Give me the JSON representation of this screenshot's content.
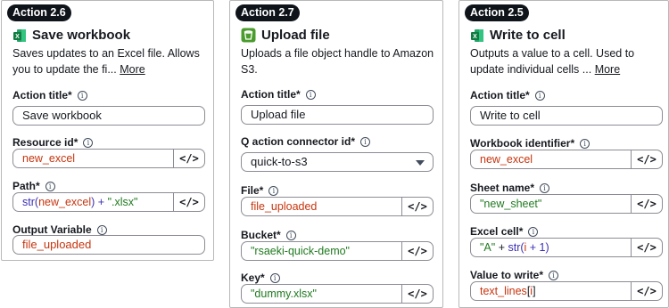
{
  "cards": [
    {
      "badge": "Action 2.6",
      "title": "Save workbook",
      "desc": "Saves updates to an Excel file. Allows you to update the fi...",
      "more": "More",
      "fields": {
        "action_title_label": "Action title*",
        "action_title_value": "Save workbook",
        "resource_id_label": "Resource id*",
        "resource_id_value": "new_excel",
        "path_label": "Path*",
        "path_func": "str(",
        "path_var": "new_excel",
        "path_mid": ") + ",
        "path_str": "\".xlsx\"",
        "output_label": "Output Variable",
        "output_value": "file_uploaded"
      }
    },
    {
      "badge": "Action 2.7",
      "title": "Upload file",
      "desc": "Uploads a file object handle to Amazon S3.",
      "fields": {
        "action_title_label": "Action title*",
        "action_title_value": "Upload file",
        "connector_label": "Q action connector id*",
        "connector_value": "quick-to-s3",
        "file_label": "File*",
        "file_value": "file_uploaded",
        "bucket_label": "Bucket*",
        "bucket_value": "\"rsaeki-quick-demo\"",
        "key_label": "Key*",
        "key_value": "\"dummy.xlsx\""
      }
    },
    {
      "badge": "Action 2.5",
      "title": "Write to cell",
      "desc": "Outputs a value to a cell. Used to update individual cells ...",
      "more": "More",
      "fields": {
        "action_title_label": "Action title*",
        "action_title_value": "Write to cell",
        "workbook_label": "Workbook identifier*",
        "workbook_value": "new_excel",
        "sheet_label": "Sheet name*",
        "sheet_value": "\"new_sheet\"",
        "cell_label": "Excel cell*",
        "cell_str": "\"A\"",
        "cell_mid": " + ",
        "cell_func": "str(",
        "cell_var": "i",
        "cell_end": " + 1)",
        "value_label": "Value to write*",
        "value_var": "text_lines",
        "value_idx_open": "[",
        "value_idx": "i",
        "value_idx_close": "]"
      }
    }
  ],
  "code_button": "</>",
  "info_glyph": "i",
  "colors": {
    "variable": "#c7350f",
    "string": "#1f7a1f",
    "function": "#3b2fb5",
    "badge_bg": "#0f141a"
  },
  "icons": {
    "excel": "excel-icon",
    "s3": "s3-icon",
    "info": "info-icon",
    "caret": "chevron-down-icon"
  }
}
